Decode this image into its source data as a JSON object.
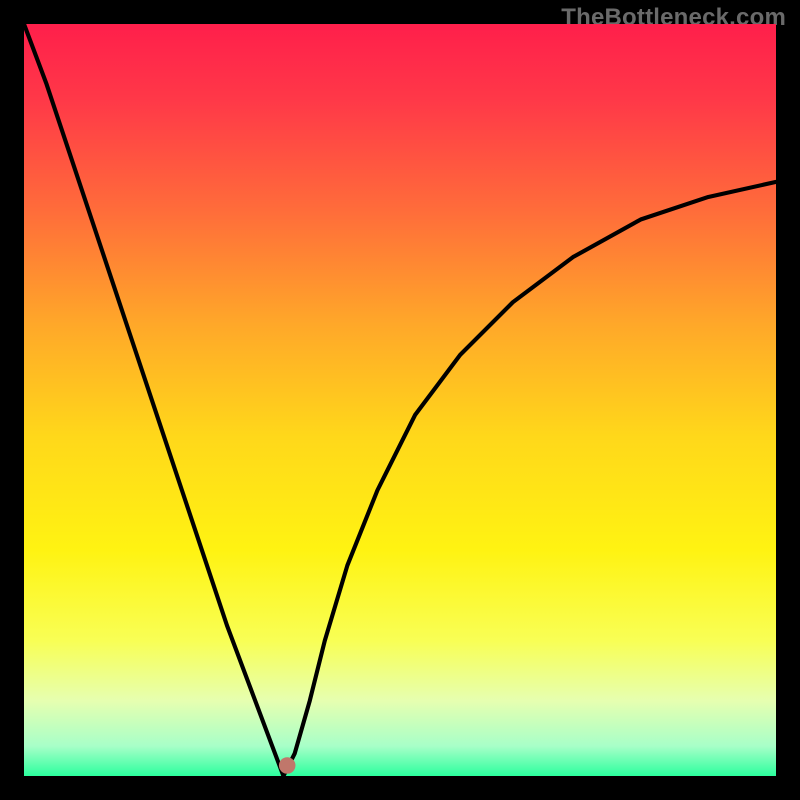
{
  "watermark": "TheBottleneck.com",
  "chart_data": {
    "type": "line",
    "title": "",
    "xlabel": "",
    "ylabel": "",
    "xlim": [
      0,
      100
    ],
    "ylim": [
      0,
      100
    ],
    "grid": false,
    "legend": false,
    "background_gradient": [
      {
        "pos": 0.0,
        "color": "#ff1f4b"
      },
      {
        "pos": 0.1,
        "color": "#ff3848"
      },
      {
        "pos": 0.25,
        "color": "#ff6d3a"
      },
      {
        "pos": 0.4,
        "color": "#ffa829"
      },
      {
        "pos": 0.55,
        "color": "#ffd81a"
      },
      {
        "pos": 0.7,
        "color": "#fff312"
      },
      {
        "pos": 0.82,
        "color": "#f8ff55"
      },
      {
        "pos": 0.9,
        "color": "#e6ffb0"
      },
      {
        "pos": 0.96,
        "color": "#a8ffc8"
      },
      {
        "pos": 1.0,
        "color": "#2cff9e"
      }
    ],
    "series": [
      {
        "name": "bottleneck-curve",
        "color": "#000000",
        "x": [
          0,
          3,
          6,
          9,
          12,
          15,
          18,
          21,
          24,
          27,
          30,
          33,
          34.5,
          36,
          38,
          40,
          43,
          47,
          52,
          58,
          65,
          73,
          82,
          91,
          100
        ],
        "y": [
          100,
          92,
          83,
          74,
          65,
          56,
          47,
          38,
          29,
          20,
          12,
          4,
          0,
          3,
          10,
          18,
          28,
          38,
          48,
          56,
          63,
          69,
          74,
          77,
          79
        ]
      }
    ],
    "marker": {
      "x": 35.0,
      "y": 1.4,
      "color": "#c0776b",
      "radius_pct": 1.1
    }
  }
}
